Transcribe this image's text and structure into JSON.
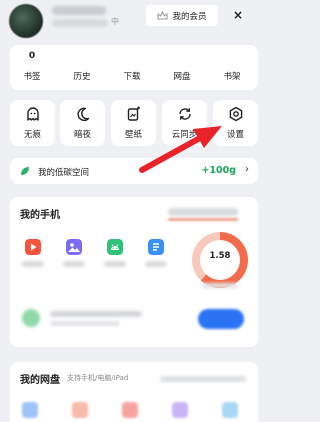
{
  "header": {
    "level_tag": "中",
    "vip_label": "我的会员",
    "close_glyph": "×"
  },
  "stats": [
    {
      "value": "0",
      "label": "书签"
    },
    {
      "value": "",
      "label": "历史"
    },
    {
      "value": "",
      "label": "下载"
    },
    {
      "value": "",
      "label": "网盘"
    },
    {
      "value": "",
      "label": "书架"
    }
  ],
  "tools": [
    {
      "label": "无痕",
      "icon": "ghost-icon"
    },
    {
      "label": "暗夜",
      "icon": "moon-icon"
    },
    {
      "label": "壁纸",
      "icon": "wallpaper-icon"
    },
    {
      "label": "云同步",
      "icon": "sync-icon"
    },
    {
      "label": "设置",
      "icon": "settings-icon"
    }
  ],
  "low_carbon": {
    "label": "我的低碳空间",
    "value": "+100g",
    "chevron": "›",
    "icon": "leaf-icon"
  },
  "my_phone": {
    "title": "我的手机",
    "gauge_text": "1.58",
    "apps": [
      {
        "icon": "video-icon",
        "color": "#f4533d"
      },
      {
        "icon": "gallery-icon",
        "color": "#7b6cf0"
      },
      {
        "icon": "android-icon",
        "color": "#2fc27a"
      },
      {
        "icon": "document-icon",
        "color": "#3a8ff5"
      }
    ]
  },
  "my_disk": {
    "title": "我的网盘",
    "subtitle": "支持手机/电脑/iPad"
  },
  "colors": {
    "accent_green": "#1aa35c",
    "annotation_arrow": "#e8232a"
  }
}
